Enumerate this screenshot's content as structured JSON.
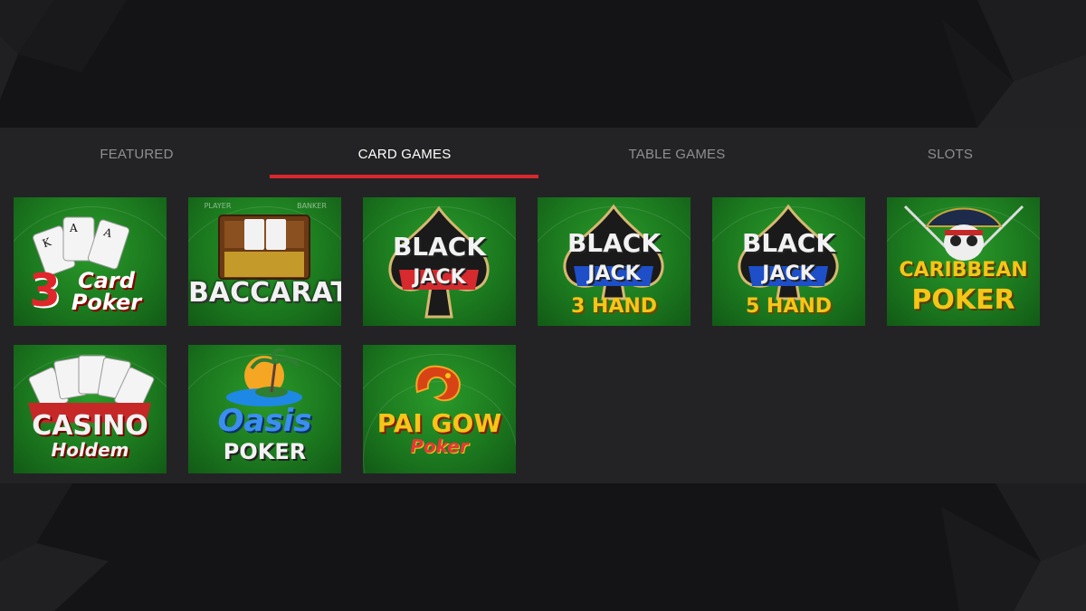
{
  "tabs": [
    {
      "label": "FEATURED",
      "active": false
    },
    {
      "label": "CARD GAMES",
      "active": true
    },
    {
      "label": "TABLE GAMES",
      "active": false
    },
    {
      "label": "SLOTS",
      "active": false
    }
  ],
  "colors": {
    "page_bg": "#141416",
    "panel_bg": "#232325",
    "tab_active": "#ffffff",
    "tab_inactive": "#8f8f93",
    "tab_underline": "#d9282d",
    "felt_green": "#1c7a1f"
  },
  "games": [
    {
      "name": "3 Card Poker",
      "logo_line1": "3",
      "logo_line2": "Card",
      "logo_line3": "Poker"
    },
    {
      "name": "Baccarat",
      "logo_line1": "BACCARAT",
      "felt_left": "PLAYER",
      "felt_right": "BANKER"
    },
    {
      "name": "Black Jack",
      "logo_line1": "BLACK",
      "logo_line2": "JACK"
    },
    {
      "name": "Black Jack 3 Hand",
      "logo_line1": "BLACK",
      "logo_line2": "JACK",
      "logo_line3": "3 HAND"
    },
    {
      "name": "Black Jack 5 Hand",
      "logo_line1": "BLACK",
      "logo_line2": "JACK",
      "logo_line3": "5 HAND"
    },
    {
      "name": "Caribbean Poker",
      "logo_line1": "CARIBBEAN",
      "logo_line2": "POKER"
    },
    {
      "name": "Casino Holdem",
      "logo_line1": "CASINO",
      "logo_line2": "Holdem"
    },
    {
      "name": "Oasis Poker",
      "logo_line1": "Oasis",
      "logo_line2": "POKER"
    },
    {
      "name": "Pai Gow Poker",
      "logo_line1": "PAI GOW",
      "logo_line2": "Poker"
    }
  ]
}
